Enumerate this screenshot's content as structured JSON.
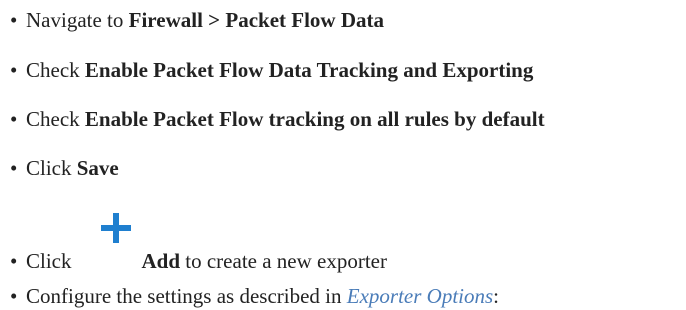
{
  "steps": [
    {
      "text": "Navigate to ",
      "bold": "Firewall > Packet Flow Data"
    },
    {
      "text": "Check ",
      "bold": "Enable Packet Flow Data Tracking and Exporting"
    },
    {
      "text": "Check ",
      "bold": "Enable Packet Flow tracking on all rules by default"
    },
    {
      "text": "Click ",
      "bold": "Save"
    },
    {
      "text": "Click",
      "icon": "add-plus-icon",
      "bold": "Add",
      "suffix": " to create a new exporter"
    },
    {
      "text": "Configure the settings as described in ",
      "link": "Exporter Options",
      "suffix": ":"
    }
  ],
  "colors": {
    "text": "#222222",
    "link": "#4a7cb8",
    "icon": "#1f7fcf"
  }
}
